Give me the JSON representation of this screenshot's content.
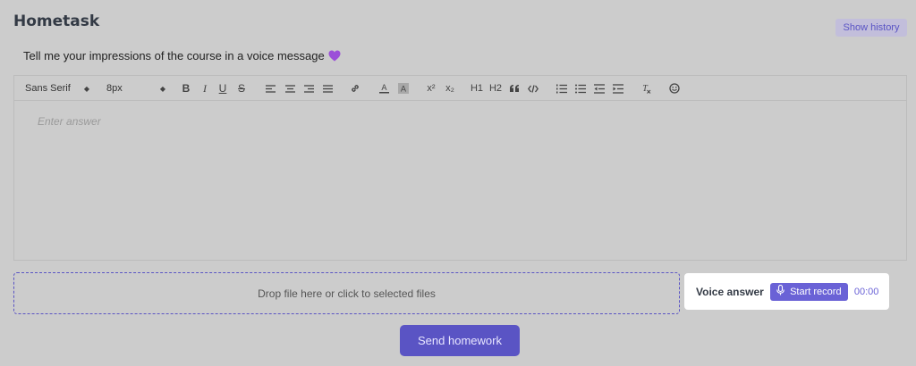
{
  "header": {
    "title": "Hometask",
    "history_label": "Show history"
  },
  "task": {
    "text": "Tell me your impressions of the course in a voice message",
    "emoji_icon": "purple-heart-icon"
  },
  "toolbar": {
    "font_select": "Sans Serif",
    "size_select": "8px",
    "bold": "B",
    "italic": "I",
    "underline": "U",
    "strike": "S",
    "superscript": "x²",
    "subscript": "x₂",
    "h1": "H1",
    "h2": "H2",
    "icons": [
      "align-left-icon",
      "align-center-icon",
      "align-right-icon",
      "align-justify-icon",
      "link-icon",
      "text-color-icon",
      "background-color-icon",
      "blockquote-icon",
      "code-icon",
      "ordered-list-icon",
      "bullet-list-icon",
      "indent-decrease-icon",
      "indent-increase-icon",
      "clear-format-icon",
      "emoji-icon"
    ]
  },
  "editor": {
    "placeholder": "Enter answer"
  },
  "dropzone": {
    "label": "Drop file here or click to selected files"
  },
  "voice": {
    "label": "Voice answer",
    "record_label": "Start record",
    "timer": "00:00"
  },
  "actions": {
    "send_label": "Send homework"
  },
  "colors": {
    "background": "#cccccc",
    "accent": "#5a54c4",
    "accent_light": "#6a62d6",
    "heart": "#9b4fd8"
  }
}
